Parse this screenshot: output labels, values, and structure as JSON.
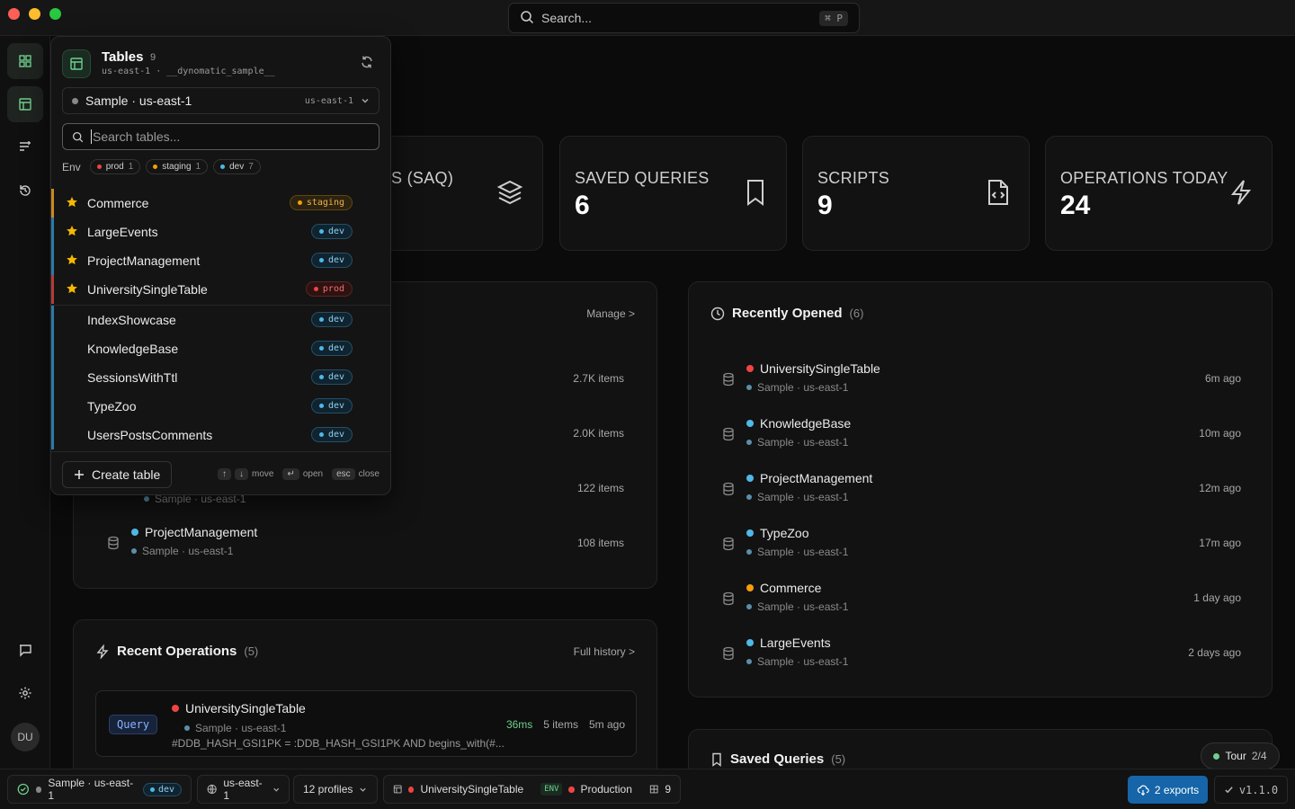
{
  "search": {
    "placeholder": "Search...",
    "shortcut": "⌘ P"
  },
  "stats": [
    {
      "label": "S (SAQ)",
      "value": "",
      "icon": "layers-icon"
    },
    {
      "label": "SAVED QUERIES",
      "value": "6",
      "icon": "bookmark-icon"
    },
    {
      "label": "SCRIPTS",
      "value": "9",
      "icon": "script-file-icon"
    },
    {
      "label": "OPERATIONS TODAY",
      "value": "24",
      "icon": "lightning-icon"
    }
  ],
  "tables_panel": {
    "manage": "Manage >",
    "rows": [
      {
        "name": "",
        "items": "2.7K items"
      },
      {
        "name": "",
        "items": "2.0K items"
      },
      {
        "name": "",
        "sub": "Sample · us-east-1",
        "items": "122 items"
      },
      {
        "name": "ProjectManagement",
        "sub": "Sample · us-east-1",
        "items": "108 items"
      }
    ]
  },
  "recent": {
    "title": "Recently Opened",
    "count": "(6)",
    "rows": [
      {
        "name": "UniversitySingleTable",
        "sub": "Sample · us-east-1",
        "time": "6m ago",
        "color": "#ef4444"
      },
      {
        "name": "KnowledgeBase",
        "sub": "Sample · us-east-1",
        "time": "10m ago",
        "color": "#4fb8e6"
      },
      {
        "name": "ProjectManagement",
        "sub": "Sample · us-east-1",
        "time": "12m ago",
        "color": "#4fb8e6"
      },
      {
        "name": "TypeZoo",
        "sub": "Sample · us-east-1",
        "time": "17m ago",
        "color": "#4fb8e6"
      },
      {
        "name": "Commerce",
        "sub": "Sample · us-east-1",
        "time": "1 day ago",
        "color": "#f59e0b"
      },
      {
        "name": "LargeEvents",
        "sub": "Sample · us-east-1",
        "time": "2 days ago",
        "color": "#4fb8e6"
      }
    ]
  },
  "operations": {
    "title": "Recent Operations",
    "count": "(5)",
    "link": "Full history >",
    "op": {
      "type": "Query",
      "table": "UniversitySingleTable",
      "sub": "Sample · us-east-1",
      "expr": "#DDB_HASH_GSI1PK = :DDB_HASH_GSI1PK AND begins_with(#...",
      "duration": "36ms",
      "items": "5 items",
      "time": "5m ago"
    }
  },
  "saved": {
    "title": "Saved Queries",
    "count": "(5)"
  },
  "dropdown": {
    "title": "Tables",
    "count": "9",
    "sub": "us-east-1 · __dynomatic_sample__",
    "connection": "Sample · us-east-1",
    "region": "us-east-1",
    "search_placeholder": "Search tables...",
    "env_label": "Env",
    "env_pills": [
      {
        "name": "prod",
        "count": "1",
        "color": "#ef4444"
      },
      {
        "name": "staging",
        "count": "1",
        "color": "#f59e0b"
      },
      {
        "name": "dev",
        "count": "7",
        "color": "#4fb8e6"
      }
    ],
    "tables": [
      {
        "name": "Commerce",
        "env": "staging",
        "fav": true
      },
      {
        "name": "LargeEvents",
        "env": "dev",
        "fav": true
      },
      {
        "name": "ProjectManagement",
        "env": "dev",
        "fav": true
      },
      {
        "name": "UniversitySingleTable",
        "env": "prod",
        "fav": true
      },
      {
        "name": "IndexShowcase",
        "env": "dev",
        "fav": false
      },
      {
        "name": "KnowledgeBase",
        "env": "dev",
        "fav": false
      },
      {
        "name": "SessionsWithTtl",
        "env": "dev",
        "fav": false
      },
      {
        "name": "TypeZoo",
        "env": "dev",
        "fav": false
      },
      {
        "name": "UsersPostsComments",
        "env": "dev",
        "fav": false
      }
    ],
    "create": "Create table",
    "hints": {
      "move": "move",
      "open": "open",
      "close": "close",
      "esc": "esc"
    }
  },
  "statusbar": {
    "connection": "Sample · us-east-1",
    "env": "dev",
    "region": "us-east-1",
    "profiles": "12 profiles",
    "table": "UniversitySingleTable",
    "env_tag": "ENV",
    "env_name": "Production",
    "table_count": "9",
    "exports": "2 exports",
    "version": "v1.1.0"
  },
  "tour": {
    "label": "Tour",
    "step": "2/4"
  },
  "user": {
    "initials": "DU"
  }
}
